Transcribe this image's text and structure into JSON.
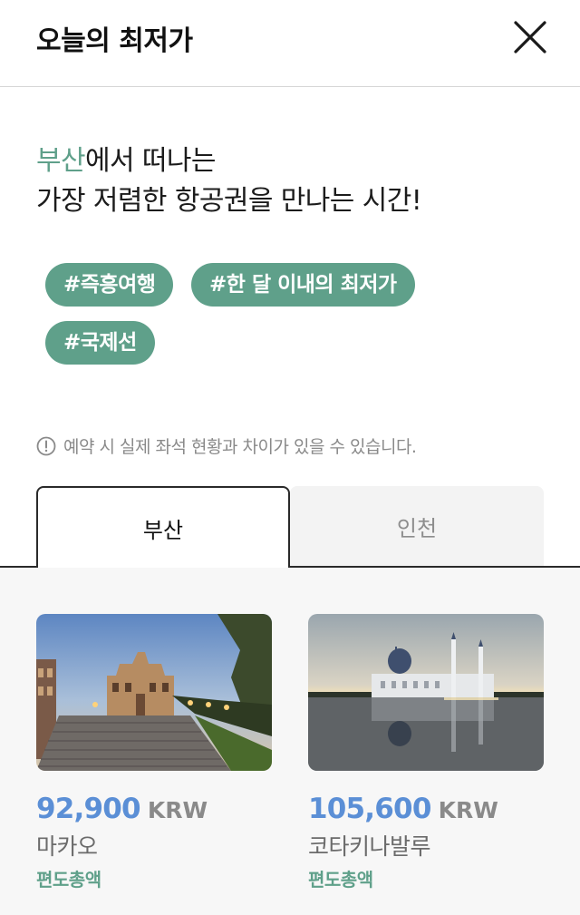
{
  "header": {
    "title": "오늘의 최저가",
    "close_icon": "close-icon"
  },
  "headline": {
    "origin": "부산",
    "line1_rest": "에서 떠나는",
    "line2": "가장 저렴한 항공권을 만나는 시간!"
  },
  "tags": [
    "#즉흥여행",
    "#한 달 이내의 최저가",
    "#국제선"
  ],
  "notice": {
    "icon": "info-icon",
    "text": "예약 시 실제 좌석 현황과 차이가 있을 수 있습니다."
  },
  "tabs": [
    {
      "label": "부산",
      "active": true
    },
    {
      "label": "인천",
      "active": false
    }
  ],
  "cards": [
    {
      "price": "92,900",
      "currency": "KRW",
      "city": "마카오",
      "trip_type": "편도총액",
      "image": "macau-ruins-photo"
    },
    {
      "price": "105,600",
      "currency": "KRW",
      "city": "코타키나발루",
      "trip_type": "편도총액",
      "image": "kota-kinabalu-mosque-photo"
    }
  ],
  "colors": {
    "accent_green": "#5fa08a",
    "price_blue": "#5b8fd6",
    "text_dark": "#1c1c1c",
    "text_gray": "#8a8a8a"
  }
}
